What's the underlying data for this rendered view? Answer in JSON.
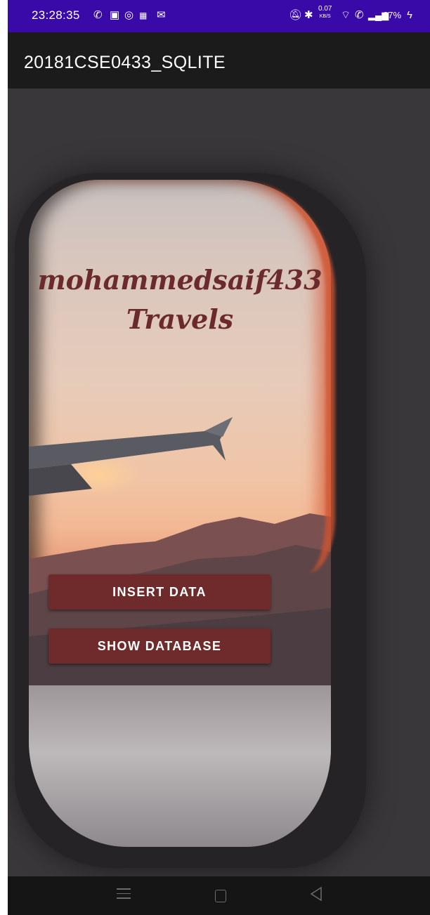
{
  "status_bar": {
    "time": "23:28:35",
    "speed_value": "0.07",
    "speed_unit": "KB/S",
    "battery": "67%",
    "left_icons": [
      "whatsapp-icon",
      "message-icon",
      "instagram-icon",
      "news-icon",
      "gmail-icon"
    ],
    "right_icons": [
      "silent-icon",
      "bluetooth-icon",
      "wifi-icon",
      "volte-icon",
      "signal-icon",
      "charging-icon"
    ]
  },
  "app_bar": {
    "title": "20181CSE0433_SQLITE"
  },
  "main": {
    "brand_line1": "mohammedsaif433",
    "brand_line2": "Travels",
    "insert_button": "INSERT DATA",
    "show_button": "SHOW DATABASE"
  },
  "nav_bar": {
    "icons": [
      "menu-icon",
      "home-icon",
      "back-icon"
    ]
  },
  "colors": {
    "status_bar": "#3a0aa8",
    "app_bar": "#1b1b1b",
    "background": "#39373a",
    "button": "#6f2b2c",
    "brand_text": "#6b2a2b"
  }
}
